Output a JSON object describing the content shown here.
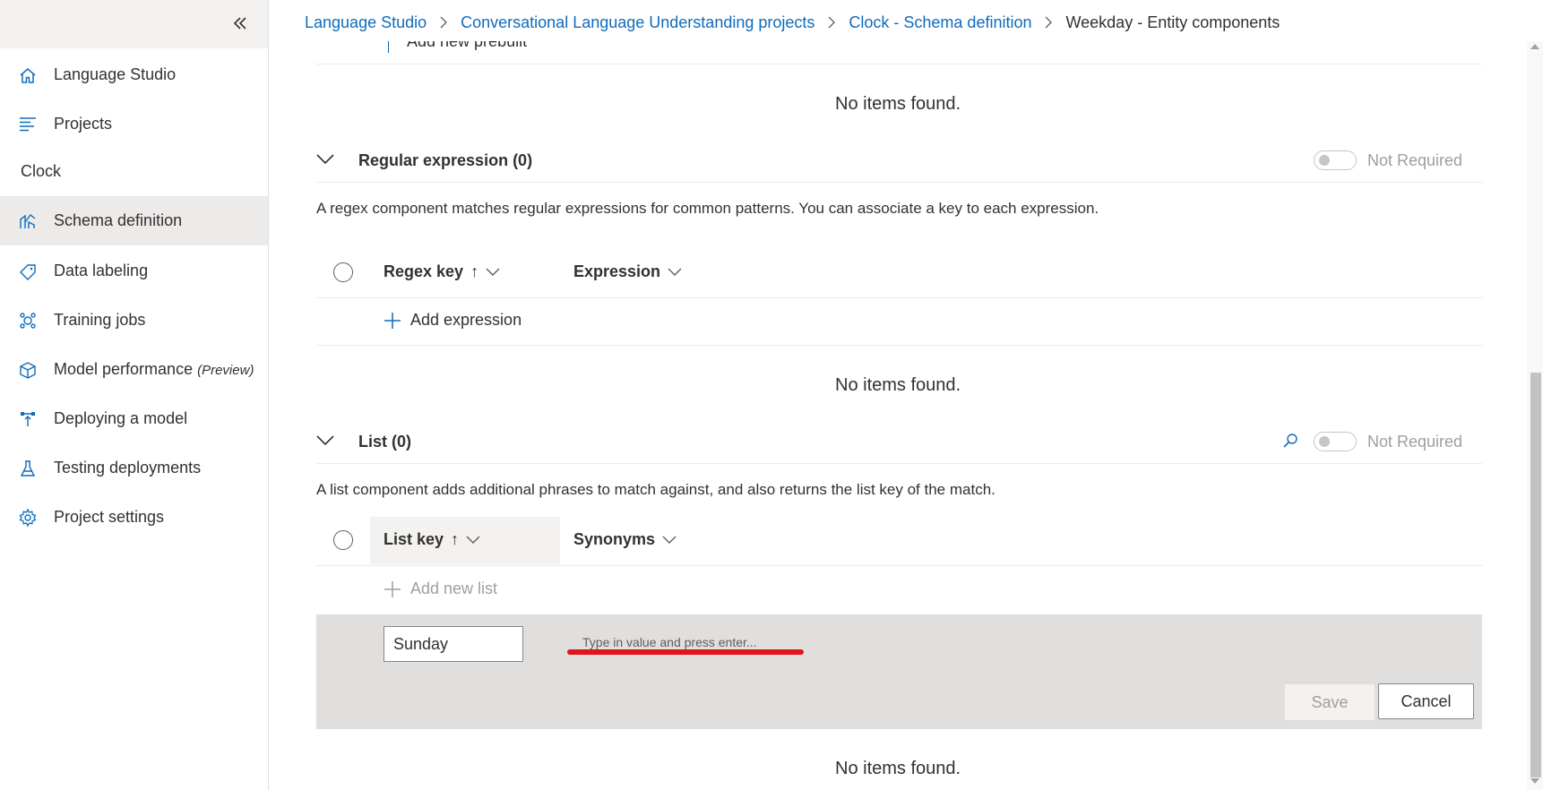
{
  "sidebar": {
    "collapse_label": "«",
    "items": [
      {
        "label": "Language Studio",
        "icon": "home-icon"
      },
      {
        "label": "Projects",
        "icon": "list-icon"
      }
    ],
    "project_name": "Clock",
    "project_items": [
      {
        "label": "Schema definition",
        "icon": "schema-icon",
        "active": true
      },
      {
        "label": "Data labeling",
        "icon": "tag-icon"
      },
      {
        "label": "Training jobs",
        "icon": "training-icon"
      },
      {
        "label": "Model performance",
        "suffix": "(Preview)",
        "icon": "cube-icon"
      },
      {
        "label": "Deploying a model",
        "icon": "deploy-icon"
      },
      {
        "label": "Testing deployments",
        "icon": "flask-icon"
      },
      {
        "label": "Project settings",
        "icon": "gear-icon"
      }
    ]
  },
  "breadcrumb": [
    "Language Studio",
    "Conversational Language Understanding projects",
    "Clock - Schema definition",
    "Weekday - Entity components"
  ],
  "prebuilt": {
    "add_label": "Add new prebuilt",
    "empty": "No items found."
  },
  "regex": {
    "title": "Regular expression (0)",
    "toggle_label": "Not Required",
    "description": "A regex component matches regular expressions for common patterns. You can associate a key to each expression.",
    "columns": [
      "Regex key",
      "Expression"
    ],
    "add_label": "Add expression",
    "empty": "No items found."
  },
  "list": {
    "title": "List (0)",
    "toggle_label": "Not Required",
    "description": "A list component adds additional phrases to match against, and also returns the list key of the match.",
    "columns": [
      "List key",
      "Synonyms"
    ],
    "add_label": "Add new list",
    "edit": {
      "key_value": "Sunday",
      "synonyms_placeholder": "Type in value and press enter...",
      "save_label": "Save",
      "cancel_label": "Cancel"
    },
    "empty": "No items found."
  },
  "colors": {
    "accent": "#0f6cbd",
    "annotation": "#e0151b"
  }
}
